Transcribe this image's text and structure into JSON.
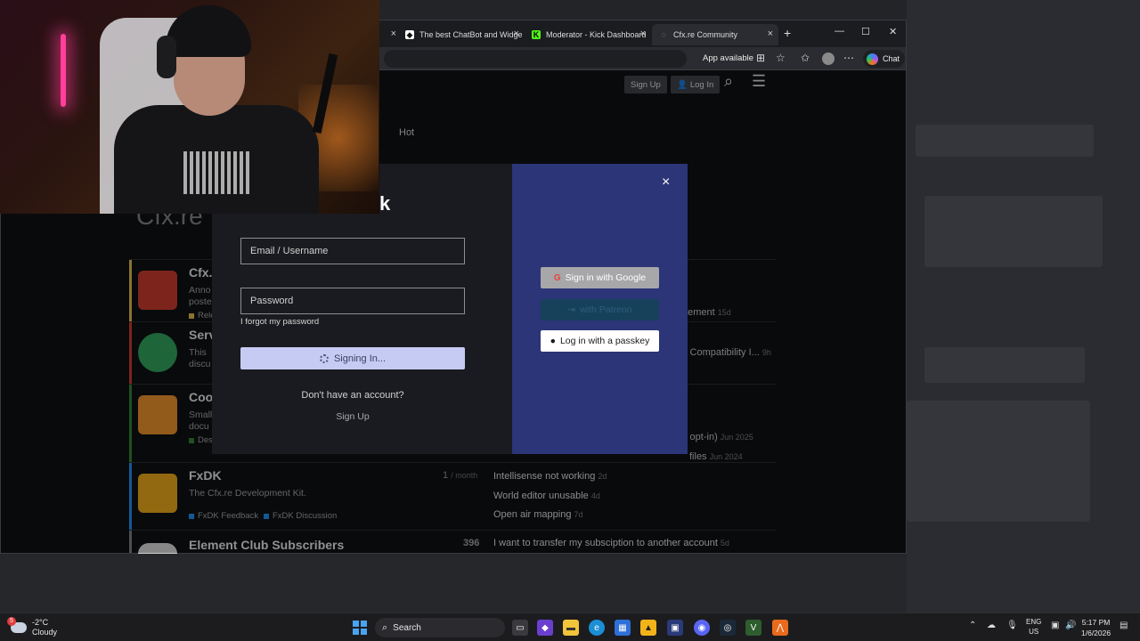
{
  "browser": {
    "tabs": [
      {
        "label": "The best ChatBot and Widge",
        "icon": "streamelements-icon"
      },
      {
        "label": "Moderator - Kick Dashboard",
        "icon": "kick-icon"
      },
      {
        "label": "Cfx.re Community",
        "icon": "cfx-icon",
        "active": true
      }
    ],
    "app_available": "App available",
    "chat_label": "Chat"
  },
  "site": {
    "signup_label": "Sign Up",
    "login_label": "Log In",
    "nav_hot": "Hot",
    "brand_partial": "Cfx.re",
    "brand_k": "k",
    "categories": [
      {
        "title": "Cfx.",
        "desc": "Anno",
        "desc2": "poste",
        "tag": "Rele",
        "color": "#d4b24a"
      },
      {
        "title": "Serv",
        "desc": "This",
        "desc2": "discu",
        "color": "#c0392b"
      },
      {
        "title": "Coo",
        "desc": "Small",
        "desc2": "docu",
        "tag": "Des",
        "color": "#2e7d32"
      },
      {
        "title": "FxDK",
        "desc": "The Cfx.re Development Kit.",
        "count": "1",
        "count_unit": "/ month",
        "tag": "FxDK Feedback",
        "tag2": "FxDK Discussion",
        "color": "#1e88e5",
        "topics": [
          {
            "text": "Intellisense not working",
            "age": "2d"
          },
          {
            "text": "World editor unusable",
            "age": "4d"
          },
          {
            "text": "Open air mapping",
            "age": "7d"
          }
        ]
      },
      {
        "title": "Element Club Subscribers",
        "count": "396",
        "color": "#7a7a7a",
        "topics": [
          {
            "text": "I want to transfer my subsciption to another account",
            "age": "5d"
          }
        ]
      }
    ],
    "right_topics": [
      {
        "text": "eement",
        "age": "15d"
      },
      {
        "text": "s Compatibility I...",
        "age": "9h"
      },
      {
        "text": "s opt-in)",
        "age": "Jun 2025"
      },
      {
        "text": "files",
        "age": "Jun 2024"
      }
    ]
  },
  "login_modal": {
    "email_placeholder": "Email / Username",
    "password_placeholder": "Password",
    "forgot": "I forgot my password",
    "signing_in": "Signing In...",
    "no_account": "Don't have an account?",
    "signup": "Sign Up",
    "google": "Sign in with Google",
    "patreon": "with Patreon",
    "passkey": "Log in with a passkey",
    "close": "×"
  },
  "taskbar": {
    "temp": "-2°C",
    "weather": "Cloudy",
    "weather_badge": "5",
    "search": "Search",
    "lang": "ENG",
    "region": "US",
    "time": "5:17 PM",
    "date": "1/6/2026"
  }
}
